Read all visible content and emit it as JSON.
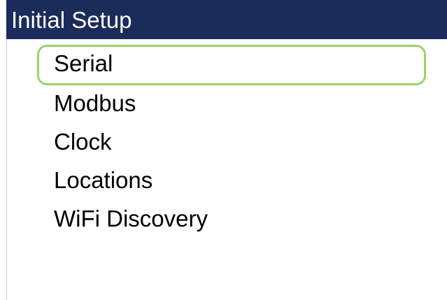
{
  "screen": {
    "title": "Initial Setup",
    "colors": {
      "title_bar": "#1b2c5b",
      "title_text": "#ffffff",
      "selection_outline": "#9bd36a",
      "item_text": "#000000"
    }
  },
  "menu": {
    "selected_index": 0,
    "items": [
      {
        "label": "Serial"
      },
      {
        "label": "Modbus"
      },
      {
        "label": "Clock"
      },
      {
        "label": "Locations"
      },
      {
        "label": "WiFi Discovery"
      }
    ]
  }
}
